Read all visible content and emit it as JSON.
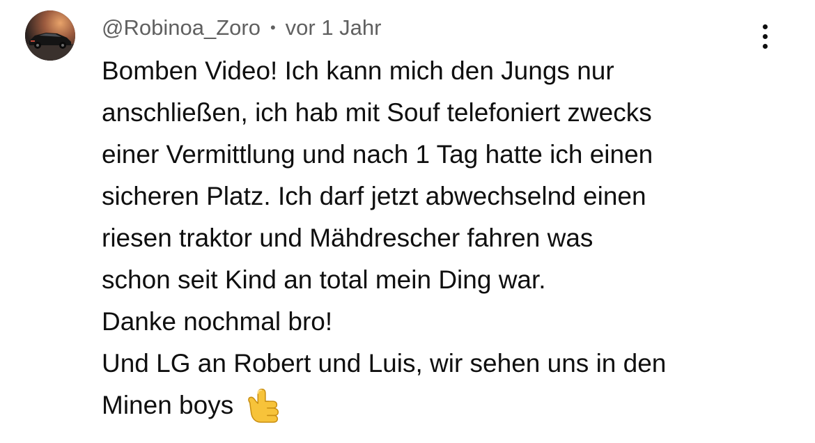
{
  "comment": {
    "author": "@Robinoa_Zoro",
    "separator": "•",
    "time": "vor 1 Jahr",
    "lines": [
      "Bomben Video! Ich kann mich den Jungs nur",
      "anschließen, ich hab mit Souf telefoniert zwecks",
      "einer Vermittlung und nach 1 Tag hatte ich einen",
      "sicheren Platz. Ich darf jetzt abwechselnd einen",
      "riesen traktor und Mähdrescher fahren was",
      "schon seit Kind an total mein Ding war.",
      "Danke nochmal bro!",
      "Und LG an Robert und Luis, wir sehen uns in den",
      "Minen boys"
    ],
    "emoji": "call-me-hand",
    "menu_icon": "more-vertical-icon",
    "avatar_icon": "sports-car-avatar"
  },
  "colors": {
    "text": "#0f0f0f",
    "secondary": "#606060",
    "background": "#ffffff"
  }
}
